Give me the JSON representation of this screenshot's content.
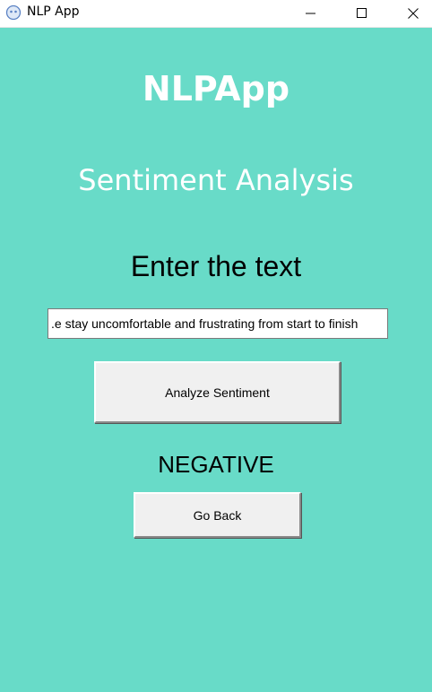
{
  "window": {
    "title": "NLP App"
  },
  "page": {
    "app_heading": "NLPApp",
    "sub_heading": "Sentiment Analysis",
    "prompt_label": "Enter the text",
    "input_value": "e stay uncomfortable and frustrating from start to finish.",
    "analyze_button": "Analyze Sentiment",
    "result": "NEGATIVE",
    "back_button": "Go Back"
  },
  "colors": {
    "background": "#68dbc8",
    "heading_text": "#ffffff",
    "button_face": "#f0f0f0"
  }
}
